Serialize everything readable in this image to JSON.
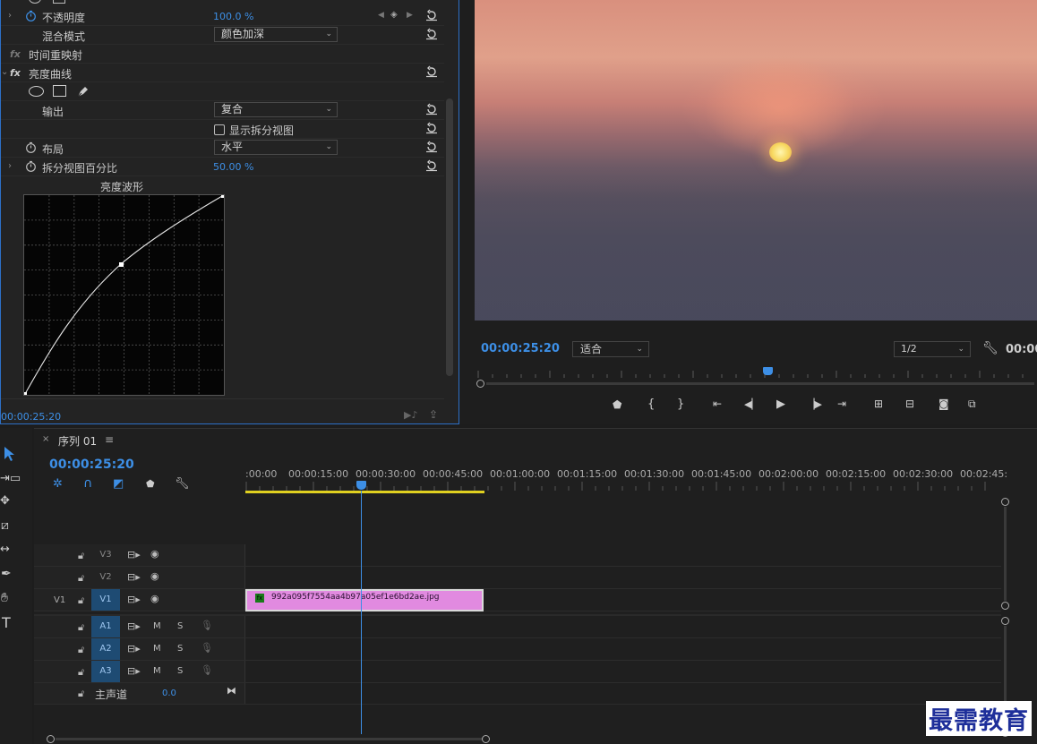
{
  "effect_controls": {
    "opacity": {
      "label": "不透明度",
      "value": "100.0 %"
    },
    "blend_mode": {
      "label": "混合模式",
      "value": "颜色加深"
    },
    "time_remap": {
      "fx": "fx",
      "label": "时间重映射"
    },
    "luma_curve": {
      "fx": "fx",
      "label": "亮度曲线"
    },
    "output": {
      "label": "输出",
      "value": "复合"
    },
    "split_view": {
      "label": "显示拆分视图"
    },
    "layout": {
      "label": "布局",
      "value": "水平"
    },
    "split_percent": {
      "label": "拆分视图百分比",
      "value": "50.00 %"
    },
    "waveform_title": "亮度波形",
    "bottom_timecode": "00:00:25:20"
  },
  "program_monitor": {
    "timecode": "00:00:25:20",
    "fit": "适合",
    "resolution": "1/2",
    "right_timecode": "00:00"
  },
  "timeline": {
    "tab_label": "序列 01",
    "timecode": "00:00:25:20",
    "ruler": [
      ":00:00",
      "00:00:15:00",
      "00:00:30:00",
      "00:00:45:00",
      "00:01:00:00",
      "00:01:15:00",
      "00:01:30:00",
      "00:01:45:00",
      "00:02:00:00",
      "00:02:15:00",
      "00:02:30:00",
      "00:02:45:"
    ],
    "video_tracks": [
      {
        "name": "V3",
        "source": ""
      },
      {
        "name": "V2",
        "source": ""
      },
      {
        "name": "V1",
        "source": "V1"
      }
    ],
    "audio_tracks": [
      {
        "name": "A1"
      },
      {
        "name": "A2"
      },
      {
        "name": "A3"
      }
    ],
    "master": {
      "label": "主声道",
      "value": "0.0"
    },
    "clip": {
      "name": "992a095f7554aa4b97a05ef1e6bd2ae.jpg",
      "fx": "fx"
    },
    "mute": "M",
    "solo": "S"
  },
  "watermark": "最需教育",
  "colors": {
    "accent": "#3d8fe6",
    "clip": "#e18ae0",
    "target": "#1e4b73",
    "work_area": "#e0d020"
  }
}
